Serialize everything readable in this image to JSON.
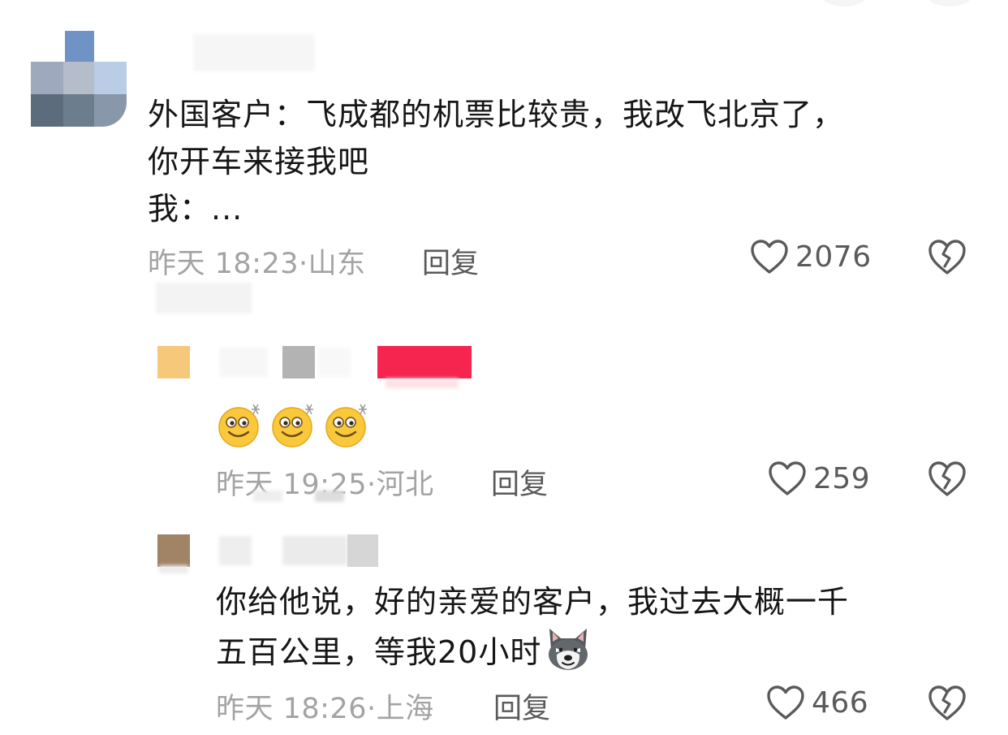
{
  "comments": [
    {
      "text": "外国客户：飞成都的机票比较贵，我改飞北京了，\n你开车来接我吧\n我：...",
      "time": "昨天 18:23",
      "location": "山东",
      "reply": "回复",
      "likes": "2076"
    },
    {
      "time": "昨天 19:25",
      "location": "河北",
      "reply": "回复",
      "likes": "259",
      "emoji_count": 3
    },
    {
      "text": "你给他说，好的亲爱的客户，我过去大概一千\n五百公里，等我20小时",
      "time": "昨天 18:26",
      "location": "上海",
      "reply": "回复",
      "likes": "466"
    }
  ],
  "colors": {
    "meta": "#a3a3a3",
    "reply": "#5a5a5a",
    "text": "#161616",
    "badge": "#f5254f",
    "avatar2": "#f6c879",
    "avatar3": "#a18366"
  },
  "icons": [
    "heart-outline-icon",
    "broken-heart-icon",
    "smiley-emoji-icon",
    "husky-dog-emoji-icon"
  ]
}
